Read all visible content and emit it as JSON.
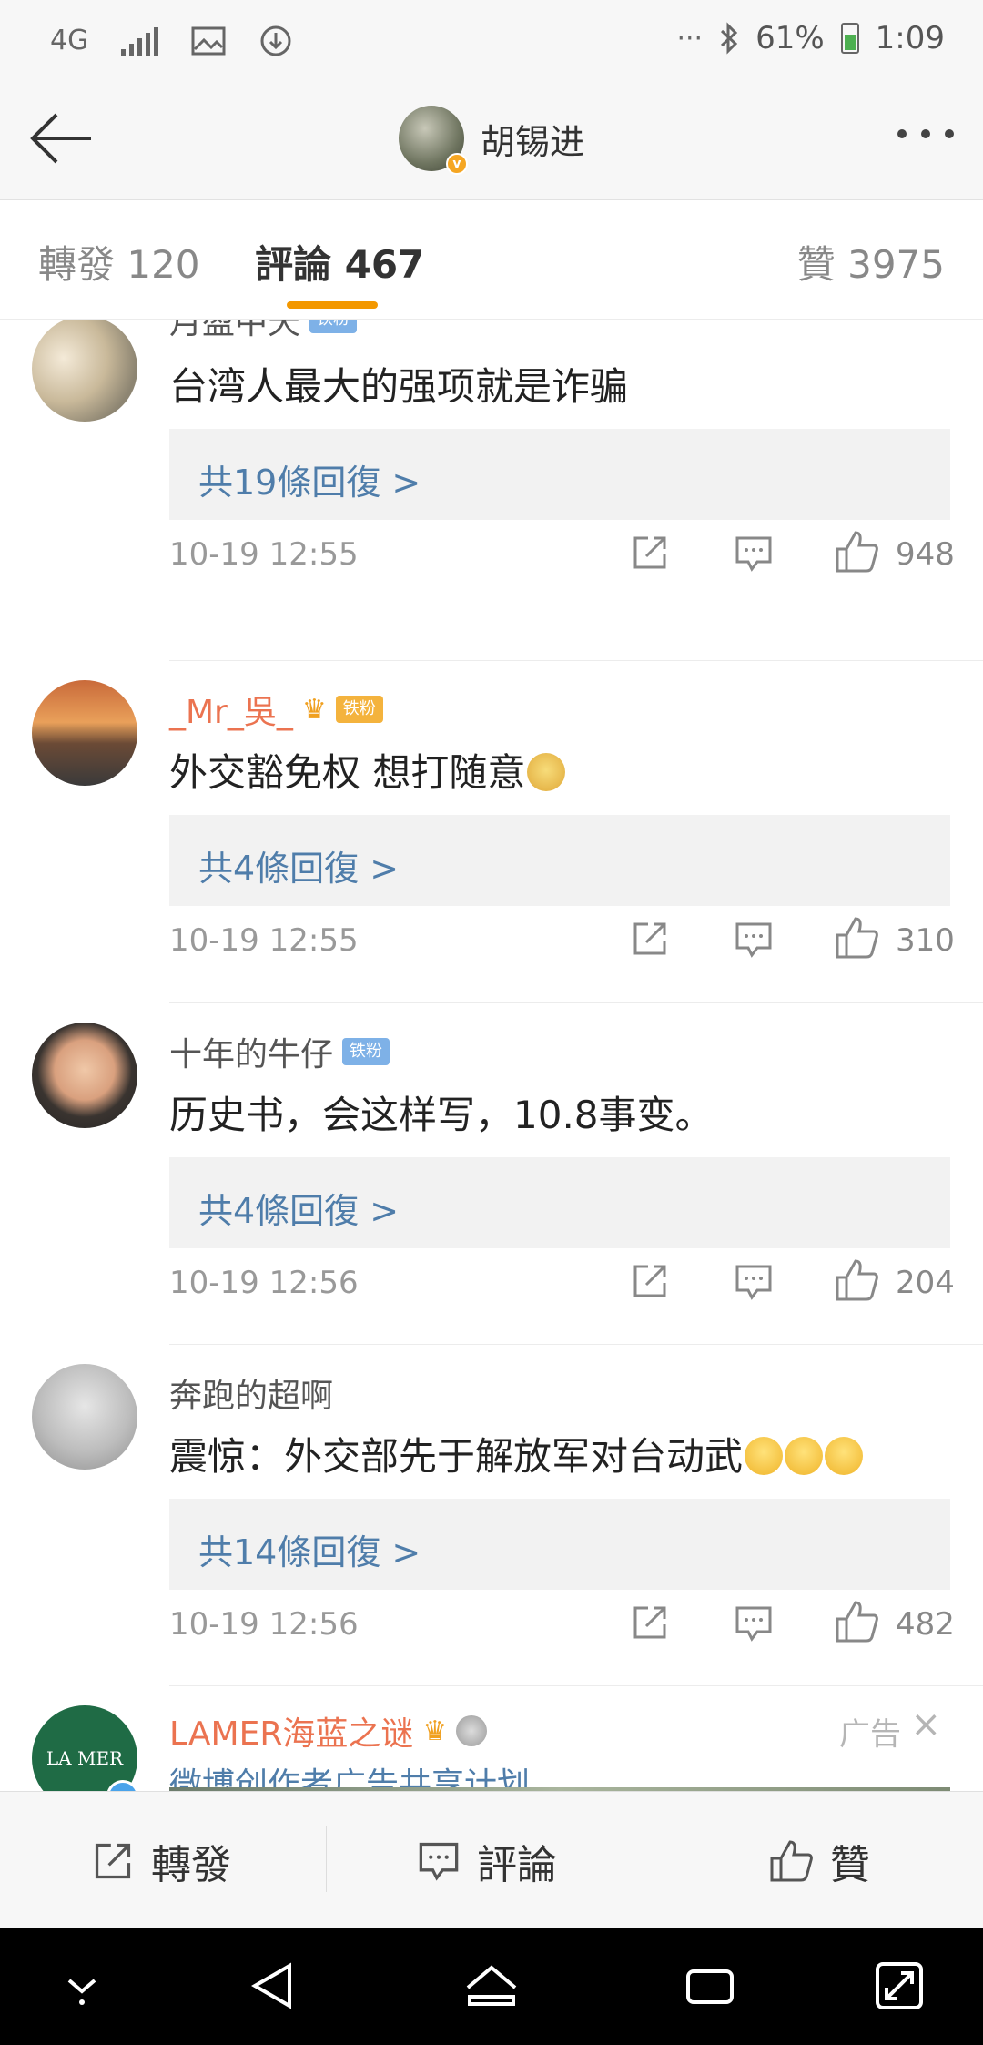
{
  "status_bar": {
    "network": "4G",
    "battery": "61%",
    "time": "1:09",
    "icons": [
      "network-4g-icon",
      "signal-icon",
      "image-icon",
      "download-icon",
      "more-dots-icon",
      "bluetooth-icon",
      "battery-icon"
    ]
  },
  "header": {
    "title": "胡锡进"
  },
  "tabs": [
    {
      "label": "轉發 120"
    },
    {
      "label": "評論 467"
    },
    {
      "label": "贊 3975"
    }
  ],
  "comments": [
    {
      "username": "月盈中天",
      "fan_badge": "铁粉",
      "text": "台湾人最大的强项就是诈骗",
      "replies": "共19條回復 >",
      "time": "10-19 12:55",
      "likes": "948"
    },
    {
      "username": "_Mr_吳_",
      "fan_badge": "铁粉",
      "text": "外交豁免权 想打随意",
      "replies": "共4條回復 >",
      "time": "10-19 12:55",
      "likes": "310"
    },
    {
      "username": "十年的牛仔",
      "fan_badge": "铁粉",
      "text": "历史书，会这样写，10.8事变。",
      "replies": "共4條回復 >",
      "time": "10-19 12:56",
      "likes": "204"
    },
    {
      "username": "奔跑的超啊",
      "text": "震惊：外交部先于解放军对台动武",
      "replies": "共14條回復 >",
      "time": "10-19 12:56",
      "likes": "482"
    }
  ],
  "ad": {
    "username": "LAMER海蓝之谜",
    "label": "广告",
    "subtitle": "微博创作者广告共享计划",
    "avatar_text": "LA MER"
  },
  "bottom_bar": {
    "repost": "轉發",
    "comment": "評論",
    "like": "贊"
  },
  "colors": {
    "accent": "#f39800",
    "link": "#4f7daa",
    "username_orange": "#eb7350"
  }
}
